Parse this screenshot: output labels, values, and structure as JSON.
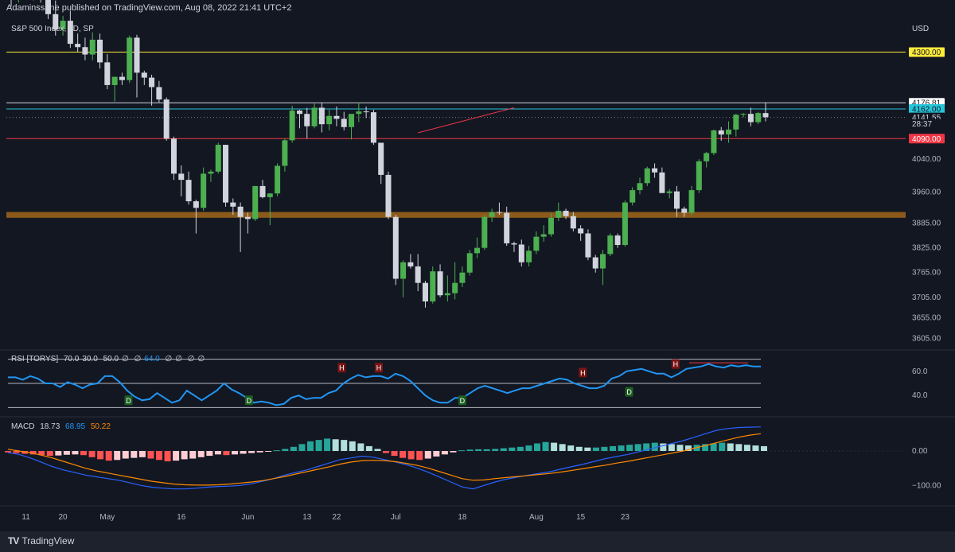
{
  "publisher_text": "Adaminssane published on TradingView.com, Aug 08, 2022 21:41 UTC+2",
  "footer": {
    "brand": "TradingView"
  },
  "colors": {
    "background": "#131722",
    "up": "#4caf50",
    "down": "#d1d4dc",
    "yellow": "#ffeb3b",
    "cyan": "#26c6da",
    "red": "#f23645",
    "zone": "#8b5a1a",
    "rsi": "#2196f3",
    "macd": "#2962ff",
    "signal": "#ff8a00"
  },
  "chart_data": [
    {
      "type": "candlestick",
      "title": "S&P 500 Index, 1D, SP",
      "currency": "USD",
      "ylim": [
        3585,
        4380
      ],
      "y_ticks": [
        "4040.00",
        "3960.00",
        "3885.00",
        "3825.00",
        "3765.00",
        "3705.00",
        "3655.00",
        "3605.00"
      ],
      "price_labels": [
        {
          "text": "4300.00",
          "value": 4300,
          "color": "#ffeb3b",
          "text_color": "#131722"
        },
        {
          "text": "4176.81",
          "value": 4177,
          "color": "#ffffff",
          "text_color": "#131722"
        },
        {
          "text": "4162.00",
          "value": 4162,
          "color": "#26c6da",
          "text_color": "#131722"
        },
        {
          "text": "4141.55",
          "value": 4141.55,
          "color": "#131722",
          "text_color": "#d1d4dc"
        },
        {
          "text": "28:37",
          "value": 4126,
          "color": "#131722",
          "text_color": "#d1d4dc"
        },
        {
          "text": "4090.00",
          "value": 4090,
          "color": "#f23645",
          "text_color": "#ffffff"
        }
      ],
      "horizontal_lines": [
        {
          "value": 4300,
          "color": "#ffeb3b"
        },
        {
          "value": 4177,
          "color": "#d1d4dc"
        },
        {
          "value": 4162,
          "color": "#26c6da"
        },
        {
          "value": 4090,
          "color": "#f23645"
        }
      ],
      "zone": {
        "from": 3898,
        "to": 3912,
        "color": "#8b5a1a"
      },
      "trendline": {
        "from": [
          55,
          4104
        ],
        "to": [
          68,
          4165
        ],
        "color": "#f23645"
      },
      "x_ticks": [
        {
          "label": "11",
          "index": 2
        },
        {
          "label": "20",
          "index": 7
        },
        {
          "label": "May",
          "index": 13
        },
        {
          "label": "16",
          "index": 23
        },
        {
          "label": "Jun",
          "index": 32
        },
        {
          "label": "13",
          "index": 40
        },
        {
          "label": "22",
          "index": 44
        },
        {
          "label": "Jul",
          "index": 52
        },
        {
          "label": "18",
          "index": 61
        },
        {
          "label": "Aug",
          "index": 71
        },
        {
          "label": "15",
          "index": 77
        },
        {
          "label": "23",
          "index": 83
        }
      ],
      "candles": [
        [
          4452,
          4480,
          4410,
          4445
        ],
        [
          4446,
          4470,
          4420,
          4460
        ],
        [
          4460,
          4470,
          4430,
          4438
        ],
        [
          4438,
          4458,
          4425,
          4450
        ],
        [
          4450,
          4462,
          4420,
          4430
        ],
        [
          4430,
          4435,
          4380,
          4392
        ],
        [
          4392,
          4425,
          4340,
          4355
        ],
        [
          4355,
          4388,
          4340,
          4376
        ],
        [
          4376,
          4400,
          4310,
          4320
        ],
        [
          4320,
          4345,
          4300,
          4312
        ],
        [
          4312,
          4335,
          4280,
          4294
        ],
        [
          4294,
          4348,
          4280,
          4330
        ],
        [
          4330,
          4345,
          4260,
          4275
        ],
        [
          4275,
          4295,
          4210,
          4220
        ],
        [
          4220,
          4240,
          4180,
          4240
        ],
        [
          4240,
          4250,
          4220,
          4232
        ],
        [
          4232,
          4340,
          4225,
          4335
        ],
        [
          4335,
          4342,
          4190,
          4250
        ],
        [
          4250,
          4255,
          4220,
          4238
        ],
        [
          4238,
          4245,
          4170,
          4215
        ],
        [
          4215,
          4230,
          4178,
          4185
        ],
        [
          4185,
          4190,
          4085,
          4090
        ],
        [
          4090,
          4095,
          3990,
          4005
        ],
        [
          4005,
          4025,
          3950,
          3990
        ],
        [
          3990,
          4010,
          3930,
          3938
        ],
        [
          3938,
          3942,
          3860,
          3922
        ],
        [
          3922,
          4020,
          3915,
          4005
        ],
        [
          4005,
          4015,
          3985,
          4010
        ],
        [
          4010,
          4080,
          4005,
          4075
        ],
        [
          4075,
          4075,
          3925,
          3935
        ],
        [
          3935,
          3945,
          3905,
          3925
        ],
        [
          3925,
          3935,
          3815,
          3900
        ],
        [
          3900,
          3910,
          3860,
          3895
        ],
        [
          3895,
          3975,
          3890,
          3975
        ],
        [
          3975,
          3990,
          3945,
          3948
        ],
        [
          3948,
          3958,
          3880,
          3957
        ],
        [
          3957,
          4030,
          3950,
          4024
        ],
        [
          4024,
          4090,
          4010,
          4086
        ],
        [
          4086,
          4170,
          4080,
          4158
        ],
        [
          4158,
          4160,
          4115,
          4150
        ],
        [
          4150,
          4165,
          4090,
          4120
        ],
        [
          4120,
          4175,
          4115,
          4165
        ],
        [
          4165,
          4178,
          4105,
          4125
        ],
        [
          4125,
          4160,
          4110,
          4145
        ],
        [
          4145,
          4168,
          4120,
          4138
        ],
        [
          4138,
          4155,
          4110,
          4118
        ],
        [
          4118,
          4120,
          4088,
          4150
        ],
        [
          4150,
          4178,
          4130,
          4156
        ],
        [
          4156,
          4168,
          4140,
          4154
        ],
        [
          4154,
          4160,
          4075,
          4080
        ],
        [
          4080,
          4080,
          3980,
          4002
        ],
        [
          4002,
          4010,
          3895,
          3900
        ],
        [
          3900,
          3905,
          3735,
          3750
        ],
        [
          3750,
          3795,
          3705,
          3790
        ],
        [
          3790,
          3810,
          3775,
          3780
        ],
        [
          3780,
          3810,
          3720,
          3740
        ],
        [
          3740,
          3745,
          3680,
          3695
        ],
        [
          3695,
          3780,
          3690,
          3768
        ],
        [
          3768,
          3785,
          3705,
          3710
        ],
        [
          3710,
          3758,
          3695,
          3715
        ],
        [
          3715,
          3790,
          3700,
          3740
        ],
        [
          3740,
          3780,
          3730,
          3765
        ],
        [
          3765,
          3820,
          3758,
          3812
        ],
        [
          3812,
          3850,
          3800,
          3825
        ],
        [
          3825,
          3905,
          3820,
          3900
        ],
        [
          3900,
          3920,
          3888,
          3912
        ],
        [
          3912,
          3935,
          3905,
          3910
        ],
        [
          3910,
          3925,
          3830,
          3836
        ],
        [
          3836,
          3840,
          3815,
          3833
        ],
        [
          3833,
          3845,
          3780,
          3790
        ],
        [
          3790,
          3830,
          3780,
          3818
        ],
        [
          3818,
          3865,
          3810,
          3852
        ],
        [
          3852,
          3880,
          3840,
          3858
        ],
        [
          3858,
          3910,
          3852,
          3898
        ],
        [
          3898,
          3935,
          3890,
          3915
        ],
        [
          3915,
          3920,
          3895,
          3902
        ],
        [
          3902,
          3912,
          3865,
          3872
        ],
        [
          3872,
          3880,
          3842,
          3860
        ],
        [
          3860,
          3870,
          3795,
          3802
        ],
        [
          3802,
          3808,
          3765,
          3775
        ],
        [
          3775,
          3820,
          3735,
          3810
        ],
        [
          3810,
          3860,
          3805,
          3855
        ],
        [
          3855,
          3860,
          3825,
          3832
        ],
        [
          3832,
          3940,
          3828,
          3935
        ],
        [
          3935,
          3972,
          3928,
          3965
        ],
        [
          3965,
          3995,
          3955,
          3982
        ],
        [
          3982,
          4022,
          3975,
          4018
        ],
        [
          4018,
          4030,
          3995,
          4008
        ],
        [
          4008,
          4020,
          3960,
          3958
        ],
        [
          3958,
          3968,
          3945,
          3962
        ],
        [
          3962,
          3975,
          3900,
          3920
        ],
        [
          3920,
          3925,
          3900,
          3910
        ],
        [
          3910,
          3975,
          3905,
          3965
        ],
        [
          3965,
          4040,
          3958,
          4035
        ],
        [
          4035,
          4058,
          4020,
          4055
        ],
        [
          4055,
          4112,
          4050,
          4110
        ],
        [
          4110,
          4118,
          4085,
          4100
        ],
        [
          4100,
          4132,
          4080,
          4112
        ],
        [
          4112,
          4150,
          4095,
          4148
        ],
        [
          4148,
          4152,
          4142,
          4150
        ],
        [
          4150,
          4165,
          4120,
          4130
        ],
        [
          4130,
          4155,
          4125,
          4152
        ],
        [
          4152,
          4178,
          4132,
          4142
        ]
      ]
    },
    {
      "type": "line",
      "title": "RSI [TORYS]",
      "legend": [
        "70.0",
        "30.0",
        "50.0",
        "∅",
        "∅",
        "64.0",
        "∅",
        "∅",
        "∅",
        "∅"
      ],
      "ylim": [
        25,
        75
      ],
      "bands": [
        70,
        50,
        30
      ],
      "y_ticks": [
        "60.0",
        "40.0"
      ],
      "values": [
        55,
        55,
        53,
        56,
        54,
        50,
        50,
        47,
        51,
        49,
        46,
        49,
        50,
        56,
        56,
        51,
        44,
        39,
        36,
        37,
        42,
        38,
        34,
        36,
        44,
        40,
        36,
        40,
        44,
        50,
        45,
        42,
        38,
        34,
        35,
        34,
        32,
        33,
        38,
        40,
        37,
        38,
        38,
        42,
        44,
        50,
        54,
        57,
        55,
        56,
        56,
        54,
        58,
        56,
        52,
        46,
        40,
        36,
        34,
        34,
        38,
        38,
        42,
        46,
        48,
        46,
        44,
        42,
        44,
        46,
        46,
        48,
        50,
        52,
        54,
        53,
        50,
        48,
        46,
        46,
        48,
        54,
        56,
        60,
        61,
        62,
        60,
        58,
        58,
        55,
        58,
        62,
        63,
        64,
        66,
        64,
        63,
        65,
        64,
        65,
        64,
        64
      ],
      "markers": [
        {
          "label": "D",
          "index": 13,
          "value": 36
        },
        {
          "label": "D",
          "index": 26,
          "value": 36
        },
        {
          "label": "H",
          "index": 36,
          "value": 63
        },
        {
          "label": "H",
          "index": 40,
          "value": 63
        },
        {
          "label": "D",
          "index": 49,
          "value": 36
        },
        {
          "label": "H",
          "index": 62,
          "value": 59
        },
        {
          "label": "D",
          "index": 67,
          "value": 43
        },
        {
          "label": "H",
          "index": 72,
          "value": 66
        }
      ]
    },
    {
      "type": "macd",
      "title": "MACD",
      "legend": [
        "18.73",
        "68.95",
        "50.22"
      ],
      "ylim": [
        -150,
        90
      ],
      "y_ticks": [
        "0.00",
        "−100.00"
      ],
      "histogram": [
        -4,
        -6,
        -8,
        -10,
        -12,
        -14,
        -13,
        -11,
        -10,
        -12,
        -18,
        -24,
        -28,
        -26,
        -22,
        -20,
        -18,
        -22,
        -26,
        -30,
        -28,
        -24,
        -22,
        -18,
        -14,
        -10,
        -12,
        -10,
        -8,
        -6,
        -4,
        -2,
        2,
        6,
        12,
        20,
        28,
        32,
        36,
        34,
        32,
        28,
        22,
        14,
        6,
        -6,
        -14,
        -20,
        -24,
        -26,
        -22,
        -16,
        -10,
        -4,
        2,
        4,
        5,
        5,
        6,
        8,
        10,
        12,
        16,
        22,
        26,
        24,
        20,
        16,
        12,
        10,
        10,
        12,
        14,
        16,
        18,
        20,
        22,
        24,
        22,
        20,
        18,
        16,
        18,
        20,
        22,
        24,
        22,
        20,
        18,
        16,
        14
      ],
      "macd": [
        -5,
        -10,
        -20,
        -32,
        -45,
        -55,
        -62,
        -70,
        -75,
        -80,
        -85,
        -92,
        -100,
        -105,
        -108,
        -110,
        -110,
        -108,
        -105,
        -103,
        -102,
        -100,
        -95,
        -88,
        -80,
        -70,
        -62,
        -55,
        -45,
        -35,
        -25,
        -20,
        -15,
        -18,
        -25,
        -32,
        -40,
        -50,
        -62,
        -76,
        -90,
        -104,
        -110,
        -100,
        -90,
        -82,
        -76,
        -70,
        -65,
        -60,
        -52,
        -45,
        -38,
        -30,
        -22,
        -16,
        -10,
        -2,
        6,
        14,
        22,
        30,
        40,
        50,
        60,
        65,
        68,
        69,
        70
      ],
      "signal": [
        5,
        0,
        -5,
        -12,
        -20,
        -30,
        -40,
        -50,
        -58,
        -64,
        -70,
        -76,
        -82,
        -88,
        -92,
        -96,
        -98,
        -99,
        -99,
        -98,
        -96,
        -93,
        -90,
        -86,
        -80,
        -74,
        -67,
        -60,
        -53,
        -46,
        -38,
        -32,
        -28,
        -27,
        -28,
        -31,
        -36,
        -42,
        -50,
        -60,
        -70,
        -80,
        -85,
        -84,
        -80,
        -77,
        -74,
        -71,
        -68,
        -65,
        -61,
        -56,
        -51,
        -46,
        -41,
        -35,
        -30,
        -24,
        -18,
        -12,
        -6,
        0,
        8,
        16,
        24,
        32,
        40,
        46,
        50
      ]
    }
  ]
}
